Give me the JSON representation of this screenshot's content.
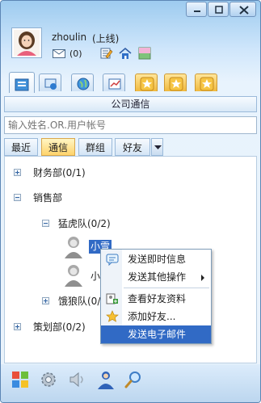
{
  "user": {
    "name": "zhoulin",
    "status": "(上线)",
    "mail_count": "(0)"
  },
  "section_title": "公司通信",
  "search": {
    "placeholder": "输入姓名.OR.用户帐号"
  },
  "filter_tabs": [
    {
      "label": "最近"
    },
    {
      "label": "通信",
      "selected": true
    },
    {
      "label": "群组"
    },
    {
      "label": "好友"
    }
  ],
  "tree": {
    "dept_finance": "财务部(0/1)",
    "dept_sales": "销售部",
    "team_tiger": "猛虎队(0/2)",
    "contact_selected": "小雪",
    "contact_2": "小",
    "team_wolf": "饿狼队(0/2)",
    "dept_planning": "策划部(0/2)"
  },
  "context_menu": {
    "send_instant": "发送即时信息",
    "send_other": "发送其他操作",
    "view_profile": "查看好友资料",
    "add_friend": "添加好友...",
    "send_email": "发送电子邮件"
  },
  "colors": {
    "selection": "#316ac5",
    "accent_tab": "#fed36b"
  },
  "icons": [
    "minimize-icon",
    "restore-icon",
    "close-icon",
    "mail-icon",
    "edit-icon",
    "home-icon",
    "picture-icon",
    "contacts-tab-icon",
    "group-tab-icon",
    "globe-tab-icon",
    "chart-tab-icon",
    "star-tab-icon",
    "start-menu-icon",
    "settings-icon",
    "sound-icon",
    "user-icon",
    "search-icon"
  ]
}
